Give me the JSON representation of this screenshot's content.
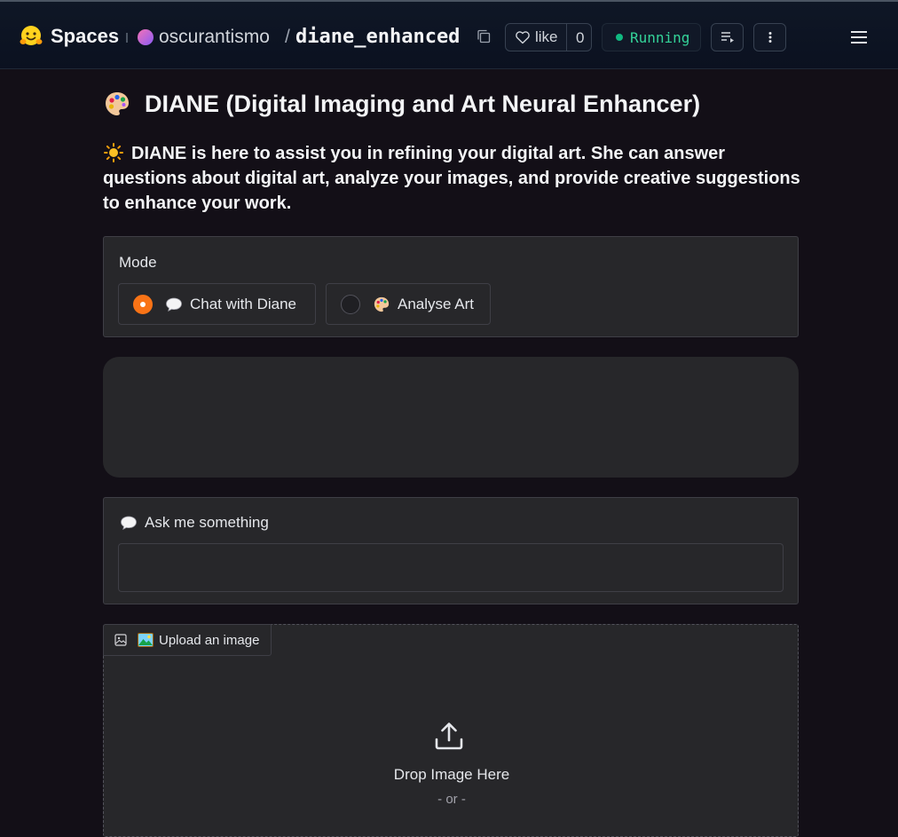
{
  "header": {
    "brand": "Spaces",
    "owner": "oscurantismo",
    "separator": "/",
    "repo": "diane_enhanced",
    "like_label": "like",
    "like_count": "0",
    "status": "Running",
    "icons": [
      "hugging-face-logo",
      "copy-icon",
      "heart-icon",
      "status-dot",
      "playlist-icon",
      "kebab-icon",
      "menu-icon"
    ]
  },
  "main": {
    "title": "DIANE (Digital Imaging and Art Neural Enhancer)",
    "intro": "DIANE is here to assist you in refining your digital art. She can answer questions about digital art, analyze your images, and provide creative suggestions to enhance your work.",
    "mode": {
      "label": "Mode",
      "options": [
        {
          "label": "Chat with Diane",
          "icon": "speech-bubble-icon",
          "selected": true
        },
        {
          "label": "Analyse Art",
          "icon": "palette-icon",
          "selected": false
        }
      ]
    },
    "ask": {
      "label": "Ask me something",
      "value": ""
    },
    "upload": {
      "tab_label": "Upload an image",
      "drop_text": "Drop Image Here",
      "or_text": "- or -"
    }
  },
  "colors": {
    "background": "#130f17",
    "panel": "#27272a",
    "accent": "#f97316",
    "status": "#34d399"
  }
}
